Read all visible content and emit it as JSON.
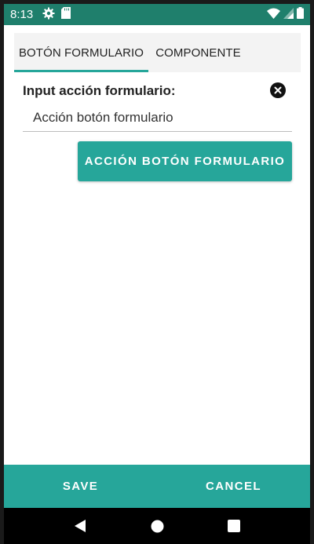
{
  "status_bar": {
    "time": "8:13",
    "icons_left": [
      "gear-icon",
      "sd-card-icon"
    ],
    "icons_right": [
      "wifi-icon",
      "signal-icon",
      "battery-icon"
    ],
    "color": "#1f7f6c"
  },
  "tabs": [
    {
      "label": "BOTÓN FORMULARIO",
      "active": true
    },
    {
      "label": "COMPONENTE",
      "active": false
    }
  ],
  "form": {
    "label": "Input acción formulario:",
    "value": "Acción botón formulario",
    "clear_icon": "clear-icon"
  },
  "action_button": {
    "label": "ACCIÓN BOTÓN FORMULARIO"
  },
  "bottom_bar": {
    "save_label": "SAVE",
    "cancel_label": "CANCEL"
  },
  "nav_bar": {
    "icons": [
      "back-icon",
      "home-icon",
      "recents-icon"
    ]
  },
  "colors": {
    "accent": "#26a69a",
    "status_bar": "#1f7f6c"
  }
}
